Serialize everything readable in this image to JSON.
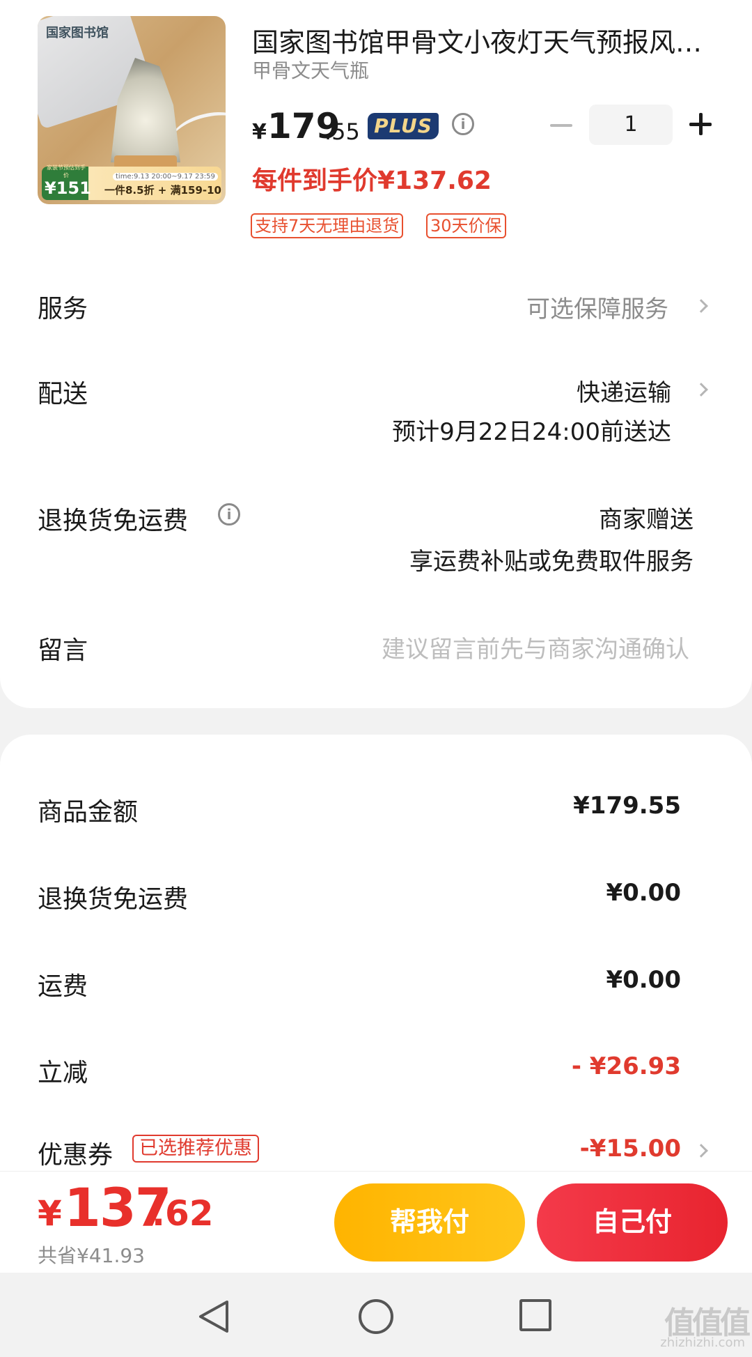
{
  "product": {
    "title": "国家图书馆甲骨文小夜灯天气预报风暴瓶",
    "spec": "甲骨文天气瓶",
    "image": {
      "brand_text": "国家图书馆",
      "promo_badge_label": "家装节预估到手价",
      "promo_badge_price": "¥151",
      "promo_time": "time:9.13 20:00~9.17 23:59",
      "promo_text": "一件8.5折 + 满159-10"
    },
    "price_yen": "¥",
    "price_int": "179",
    "price_dec": ".55",
    "plus_badge": "PLUS",
    "quantity": "1",
    "arrival_price": "每件到手价¥137.62",
    "tags": [
      "支持7天无理由退货",
      "30天价保"
    ]
  },
  "rows": {
    "service": {
      "label": "服务",
      "value": "可选保障服务"
    },
    "delivery": {
      "label": "配送",
      "value": "快递运输",
      "eta": "预计9月22日24:00前送达"
    },
    "return_freight": {
      "label": "退换货免运费",
      "value": "商家赠送",
      "note": "享运费补贴或免费取件服务"
    },
    "message": {
      "label": "留言",
      "placeholder": "建议留言前先与商家沟通确认"
    }
  },
  "summary": {
    "goods": {
      "label": "商品金额",
      "value": "¥179.55"
    },
    "return_freight": {
      "label": "退换货免运费",
      "value": "¥0.00"
    },
    "shipping": {
      "label": "运费",
      "value": "¥0.00"
    },
    "discount": {
      "label": "立减",
      "value": "- ¥26.93"
    },
    "coupon": {
      "label": "优惠券",
      "tag": "已选推荐优惠",
      "value": "-¥15.00"
    }
  },
  "footer": {
    "total_yen": "¥",
    "total_int": "137",
    "total_dec": ".62",
    "saved": "共省¥41.93",
    "help_pay": "帮我付",
    "self_pay": "自己付"
  },
  "watermark": {
    "main": "值值值",
    "sub": "zhizhizhi.com"
  },
  "colors": {
    "accent_red": "#e03a2e",
    "plus_navy": "#1c3a72",
    "help_yellow": "#ffb400",
    "pay_red": "#f43a4a"
  }
}
